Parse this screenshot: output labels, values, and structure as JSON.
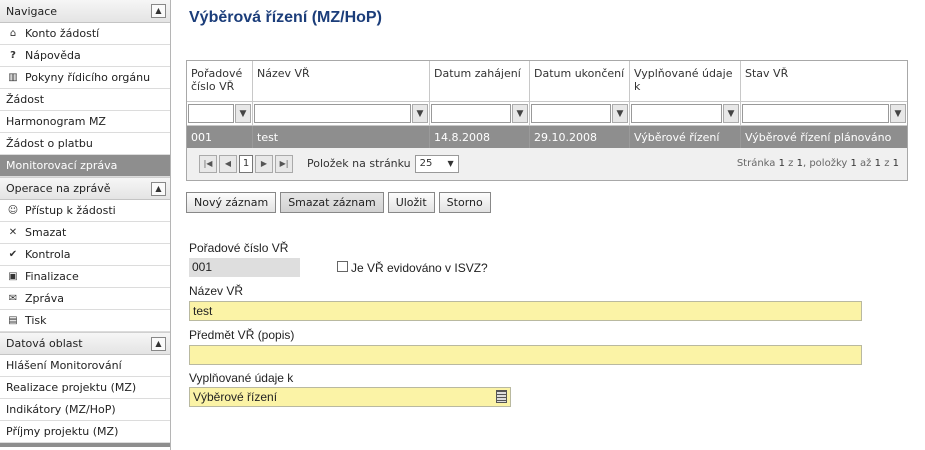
{
  "sidebar": {
    "navigace": {
      "title": "Navigace",
      "items": [
        {
          "label": "Konto žádostí",
          "icon": "home-icon"
        },
        {
          "label": "Nápověda",
          "icon": "help-icon"
        },
        {
          "label": "Pokyny řídicího orgánu",
          "icon": "book-icon"
        }
      ],
      "plain_items": [
        "Žádost",
        "Harmonogram MZ",
        "Žádost o platbu"
      ],
      "active_item": "Monitorovací zpráva"
    },
    "operace": {
      "title": "Operace na zprávě",
      "items": [
        {
          "label": "Přístup k žádosti",
          "icon": "user-icon"
        },
        {
          "label": "Smazat",
          "icon": "delete-icon"
        },
        {
          "label": "Kontrola",
          "icon": "check-icon"
        },
        {
          "label": "Finalizace",
          "icon": "lock-icon"
        },
        {
          "label": "Zpráva",
          "icon": "mail-icon"
        },
        {
          "label": "Tisk",
          "icon": "print-icon"
        }
      ]
    },
    "datova": {
      "title": "Datová oblast",
      "items": [
        "Hlášení Monitorování",
        "Realizace projektu (MZ)",
        "Indikátory (MZ/HoP)",
        "Příjmy projektu (MZ)"
      ]
    }
  },
  "main": {
    "title": "Výběrová řízení (MZ/HoP)",
    "grid": {
      "columns": [
        "Pořadové číslo VŘ",
        "Název VŘ",
        "Datum zahájení",
        "Datum ukončení",
        "Vyplňované údaje k",
        "Stav VŘ"
      ],
      "rows": [
        [
          "001",
          "test",
          "14.8.2008",
          "29.10.2008",
          "Výběrové řízení",
          "Výběrové řízení plánováno"
        ]
      ],
      "pager": {
        "current_page": "1",
        "page_size_label": "Položek na stránku",
        "page_size": "25",
        "info_page": "Stránka",
        "page_num": "1",
        "of": "z",
        "total_pages": "1",
        "items_label": ", položky",
        "from": "1",
        "to_label": "až",
        "to": "1",
        "of2": "z",
        "total_items": "1"
      }
    },
    "buttons": {
      "new": "Nový záznam",
      "delete": "Smazat záznam",
      "save": "Uložit",
      "cancel": "Storno"
    },
    "form": {
      "order_label": "Pořadové číslo VŘ",
      "order_value": "001",
      "isvz_label": "Je VŘ evidováno v ISVZ?",
      "name_label": "Název VŘ",
      "name_value": "test",
      "subject_label": "Předmět VŘ (popis)",
      "subject_value": "",
      "data_for_label": "Vyplňované údaje k",
      "data_for_value": "Výběrové řízení"
    }
  },
  "colors": {
    "title": "#1b3d7a",
    "selected_row": "#8e8e8e",
    "input_yellow": "#fbf3a6"
  }
}
